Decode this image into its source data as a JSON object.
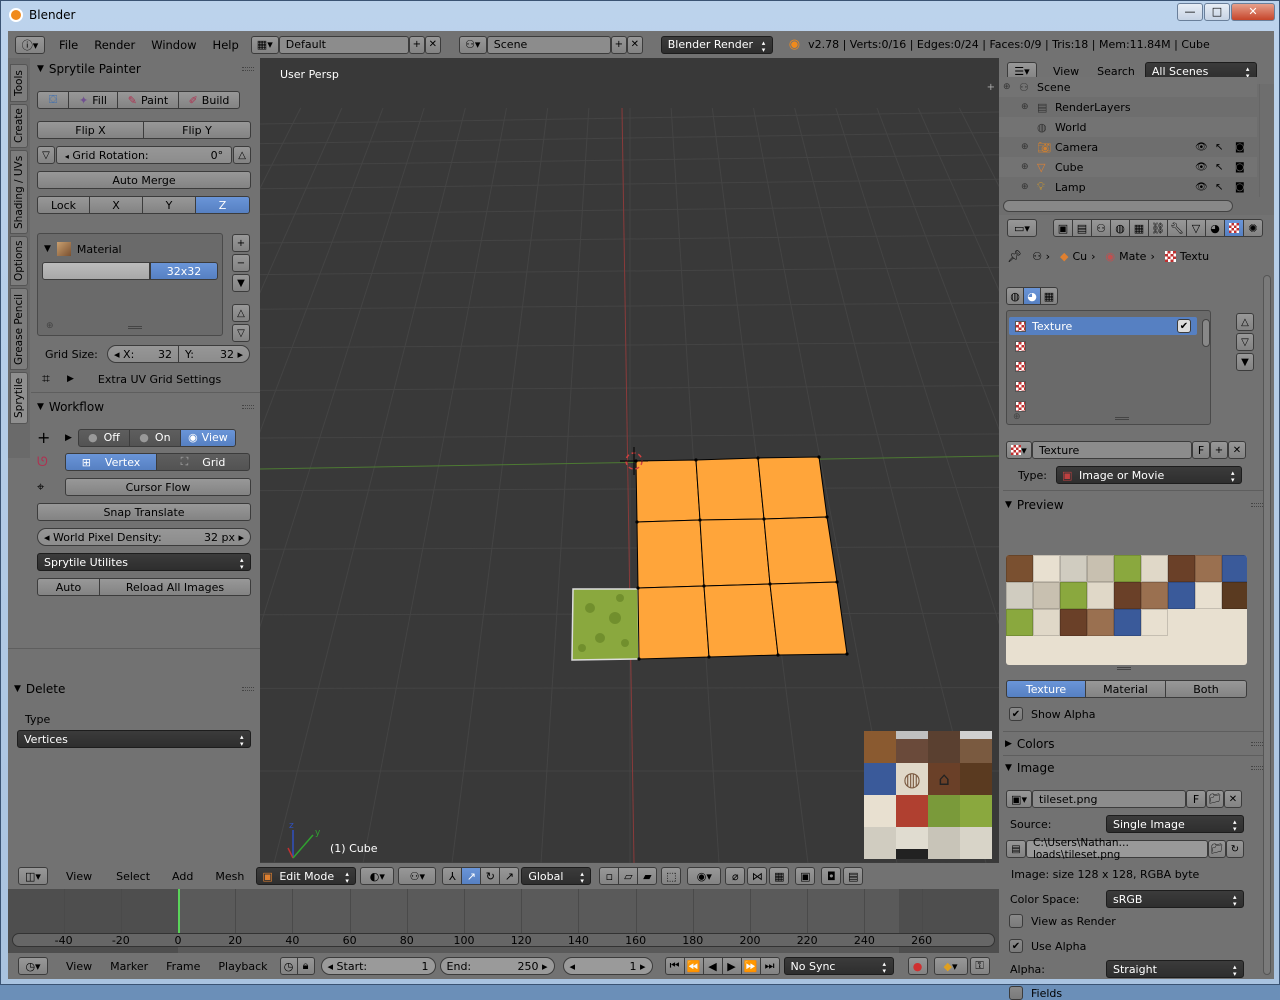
{
  "window": {
    "title": "Blender",
    "buttons": {
      "minimize": "—",
      "maximize": "□",
      "close": "✕"
    }
  },
  "infobar": {
    "menus": [
      "File",
      "Render",
      "Window",
      "Help"
    ],
    "layout": "Default",
    "scene": "Scene",
    "engine": "Blender Render",
    "stats": "v2.78 | Verts:0/16 | Edges:0/24 | Faces:0/9 | Tris:18 | Mem:11.84M | Cube"
  },
  "left_tabs": [
    "Tools",
    "Create",
    "Shading / UVs",
    "Options",
    "Grease Pencil",
    "Sprytile"
  ],
  "sprytile_painter": {
    "title": "Sprytile Painter",
    "modes": [
      "",
      "Fill",
      "Paint",
      "Build"
    ],
    "flip_x": "Flip X",
    "flip_y": "Flip Y",
    "grid_rotation_label": "Grid Rotation:",
    "grid_rotation_value": "0°",
    "auto_merge": "Auto Merge",
    "lock_axes": [
      "Lock",
      "X",
      "Y",
      "Z"
    ],
    "material_label": "Material",
    "material_grid": "32x32",
    "grid_size_label": "Grid Size:",
    "grid_x_label": "X:",
    "grid_x": "32",
    "grid_y_label": "Y:",
    "grid_y": "32",
    "extra_uv": "Extra UV Grid Settings"
  },
  "workflow": {
    "title": "Workflow",
    "snap_states": [
      "Off",
      "On",
      "View"
    ],
    "snap_modes": [
      "Vertex",
      "Grid"
    ],
    "cursor_flow": "Cursor Flow",
    "snap_translate": "Snap Translate",
    "world_pixel_label": "World Pixel Density:",
    "world_pixel_value": "32 px",
    "utilities": "Sprytile Utilites",
    "auto": "Auto",
    "reload": "Reload All Images"
  },
  "delete_panel": {
    "title": "Delete",
    "type_label": "Type",
    "type_value": "Vertices"
  },
  "viewport": {
    "perspective": "User Persp",
    "object": "(1) Cube"
  },
  "view_header": {
    "menus": [
      "View",
      "Select",
      "Add",
      "Mesh"
    ],
    "mode": "Edit Mode",
    "orientation": "Global"
  },
  "timeline": {
    "ticks": [
      "-40",
      "-20",
      "0",
      "20",
      "40",
      "60",
      "80",
      "100",
      "120",
      "140",
      "160",
      "180",
      "200",
      "220",
      "240",
      "260"
    ],
    "current_frame": 0,
    "menus": [
      "View",
      "Marker",
      "Frame",
      "Playback"
    ],
    "start_label": "Start:",
    "start": "1",
    "end_label": "End:",
    "end": "250",
    "frame": "1",
    "sync": "No Sync"
  },
  "outliner": {
    "menus": [
      "View",
      "Search"
    ],
    "filter": "All Scenes",
    "items": [
      {
        "name": "Scene",
        "level": 0
      },
      {
        "name": "RenderLayers",
        "level": 1
      },
      {
        "name": "World",
        "level": 1
      },
      {
        "name": "Camera",
        "level": 1
      },
      {
        "name": "Cube",
        "level": 1
      },
      {
        "name": "Lamp",
        "level": 1
      }
    ]
  },
  "properties": {
    "breadcrumb": [
      "Cu",
      "Mate",
      "Textu"
    ],
    "texture_slots": [
      "Texture",
      "",
      "",
      "",
      ""
    ],
    "texture_name": "Texture",
    "texture_f": "F",
    "type_label": "Type:",
    "type_value": "Image or Movie",
    "preview_title": "Preview",
    "preview_tabs": [
      "Texture",
      "Material",
      "Both"
    ],
    "show_alpha": "Show Alpha",
    "colors_title": "Colors",
    "image_title": "Image",
    "image_name": "tileset.png",
    "image_f": "F",
    "source_label": "Source:",
    "source_value": "Single Image",
    "filepath": "C:\\Users\\Nathan…loads\\tileset.png",
    "image_info": "Image: size 128 x 128, RGBA byte",
    "colorspace_label": "Color Space:",
    "colorspace_value": "sRGB",
    "view_as_render": "View as Render",
    "use_alpha": "Use Alpha",
    "alpha_label": "Alpha:",
    "alpha_value": "Straight",
    "fields": "Fields"
  },
  "colors": {
    "accent": "#5680c2",
    "face_selected": "#ffa53a",
    "grass": "#8aa83e",
    "background": "#393939"
  }
}
